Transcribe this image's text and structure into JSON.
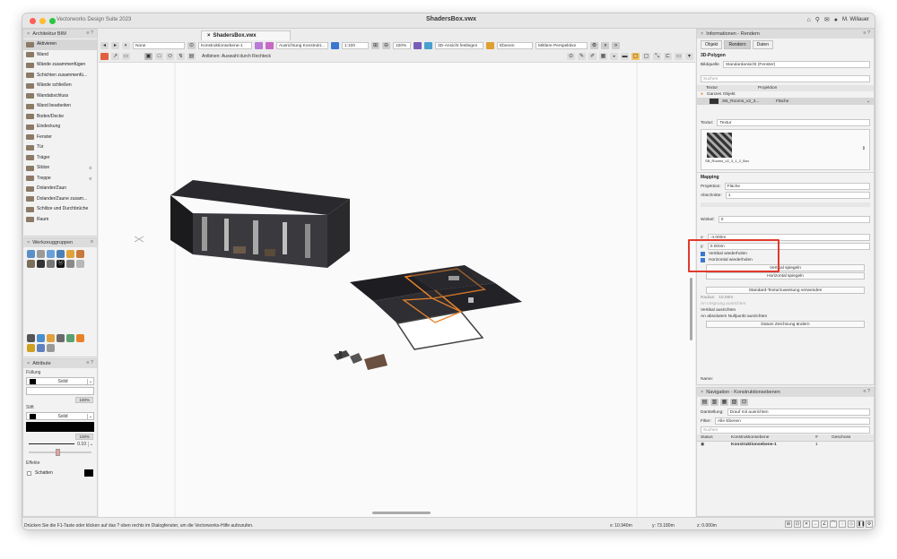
{
  "window": {
    "app_title": "Vectorworks Design Suite 2023",
    "doc_title": "ShadersBox.vwx",
    "user": "M. Willauer"
  },
  "doc_tab": "ShadersBox.vwx",
  "left_panel": {
    "title": "Architektur BIM",
    "items": [
      {
        "label": "Aktivieren",
        "num": ""
      },
      {
        "label": "Wand",
        "num": ""
      },
      {
        "label": "Wände zusammenfügen",
        "num": ""
      },
      {
        "label": "Schichten zusammenfü...",
        "num": ""
      },
      {
        "label": "Wände schließen",
        "num": ""
      },
      {
        "label": "Wandabschluss",
        "num": ""
      },
      {
        "label": "Wand bearbeiten",
        "num": ""
      },
      {
        "label": "Boden/Decke",
        "num": ""
      },
      {
        "label": "Eindeckung",
        "num": ""
      },
      {
        "label": "Fenster",
        "num": ""
      },
      {
        "label": "Tür",
        "num": ""
      },
      {
        "label": "Träger",
        "num": ""
      },
      {
        "label": "Stütze",
        "num": "0"
      },
      {
        "label": "Treppe",
        "num": "0"
      },
      {
        "label": "Dolander/Zaun",
        "num": ""
      },
      {
        "label": "Dolander/Zaune zusam...",
        "num": ""
      },
      {
        "label": "Schlitze und Durchbrüche",
        "num": ""
      },
      {
        "label": "Raum",
        "num": ""
      }
    ]
  },
  "tool_groups": {
    "title": "Werkzeuggruppen"
  },
  "attributes": {
    "title": "Attribute",
    "fill_label": "Füllung",
    "fill_value": "Solid",
    "fill_pct": "100%",
    "pen_label": "Stift",
    "pen_value": "Solid",
    "pen_pct": "100%",
    "line_weight": "0.10",
    "effects_label": "Effekte",
    "shadow_label": "Schatten"
  },
  "toolbar": {
    "class": "None",
    "layer": "Konstruktionsebene-1",
    "design_layer": "Ausrichtung Konstrukt...",
    "scale": "1:100",
    "zoom": "100%",
    "view": "3D-Ansicht festlegen",
    "light": "Ebenen",
    "render": "Mittlere Perspektive",
    "mode_hint": "Anlbinen: Auswahl durch Rechteck"
  },
  "info_panel": {
    "title": "Informationen - Rendern",
    "tabs": [
      "Objekt",
      "Rendern",
      "Daten"
    ],
    "section_title": "3D-Polygon",
    "bg_label": "Bildquelle",
    "bg_value": "Standardansicht (Fenster)",
    "search_placeholder": "Suchen",
    "col_texture": "Textur",
    "col_projection": "Projektion",
    "group_row": "Ganzes Objekt",
    "item_name": "SB_Rooms_v2_3...",
    "item_proj": "Fläche",
    "texture_label": "Textur:",
    "texture_value": "Textur",
    "thumb_caption": "SB_Rooms_v2_3_1_2_Box",
    "mapping_title": "Mapping",
    "projection_label": "Projektion:",
    "projection_value": "Fläche",
    "sections_label": "Abschnitte:",
    "sections_value": "1",
    "angle_label": "Winkel:",
    "angle_value": "0",
    "x_label": "x:",
    "x_value": "-4.000m",
    "y_label": "y:",
    "y_value": "0.000m",
    "check_vertical": "Vertikal wiederholen",
    "check_horizontal": "Horizontal wiederholen",
    "btn_mirror_v": "Vertikal spiegeln",
    "btn_mirror_h": "Horizontal spiegeln",
    "btn_reset": "Standard-Texturzuweisung verwenden",
    "radius_label": "Radius:",
    "radius_value": "10.00m",
    "text_on_surface": "An Ursprung ausrichten",
    "text_vertical": "Vertikal ausrichten",
    "text_absolute": "An absolutem Nullpunkt ausrichten",
    "btn_edit": "Datum Zeichnung ändern",
    "name_label": "Name:"
  },
  "nav_panel": {
    "title": "Navigation - Konstruktionsebenen",
    "display_label": "Darstellung:",
    "display_value": "Drauf mit ausrichten",
    "filter_label": "Filter:",
    "filter_value": "Alle Ebenen",
    "search_placeholder": "Suchen",
    "columns": [
      "Status",
      "Konstruktionsebene",
      "#",
      "Geschoss"
    ],
    "rows": [
      {
        "name": "Konstruktionsebene-1",
        "num": "1",
        "story": ""
      }
    ]
  },
  "statusbar": {
    "hint": "Drücken Sie die F1-Taste oder klicken auf das ? oben rechts im Dialogfenster, um die Vectorworks-Hilfe aufzurufen.",
    "x": "x: 10.940m",
    "y": "y: 73.180m",
    "z": "z: 0.000m"
  },
  "colors": {
    "accent": "#e8822a",
    "highlight_box": "#e03a2e",
    "panel_bg": "#f2f2f2"
  }
}
